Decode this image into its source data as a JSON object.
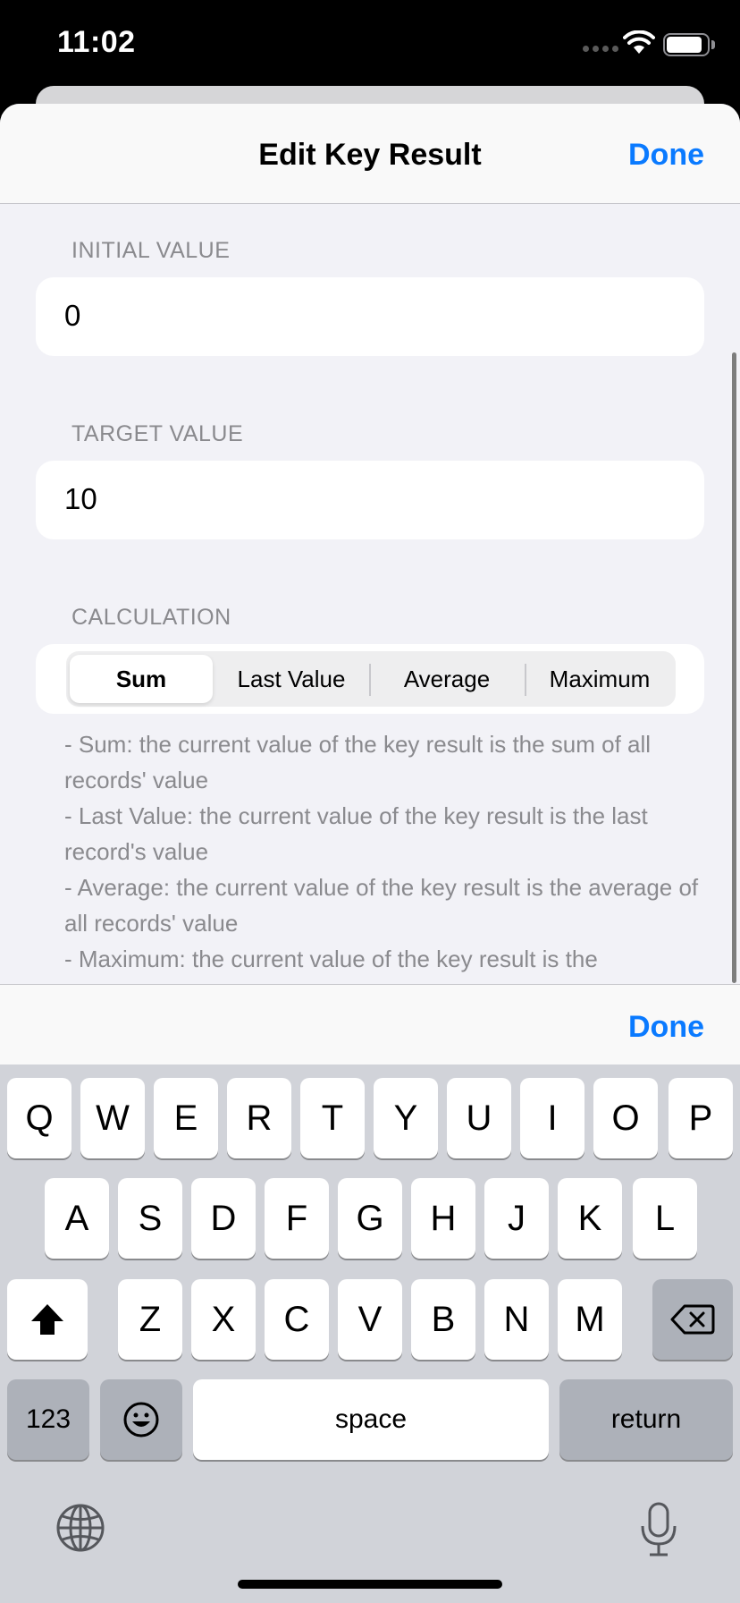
{
  "status_bar": {
    "time": "11:02"
  },
  "nav": {
    "title": "Edit Key Result",
    "done": "Done"
  },
  "form": {
    "initial_value": {
      "label": "INITIAL VALUE",
      "value": "0"
    },
    "target_value": {
      "label": "TARGET VALUE",
      "value": "10"
    },
    "calculation": {
      "label": "CALCULATION",
      "options": [
        "Sum",
        "Last Value",
        "Average",
        "Maximum"
      ],
      "selected": "Sum",
      "help": [
        "- Sum: the current value of the key result is the sum of all records' value",
        "- Last Value: the current value of the key result is the last record's value",
        "- Average: the current value of the key result is the average of all records' value",
        "- Maximum: the current value of the key result is the"
      ]
    }
  },
  "accessory": {
    "done": "Done"
  },
  "keyboard": {
    "row1": [
      "Q",
      "W",
      "E",
      "R",
      "T",
      "Y",
      "U",
      "I",
      "O",
      "P"
    ],
    "row2": [
      "A",
      "S",
      "D",
      "F",
      "G",
      "H",
      "J",
      "K",
      "L"
    ],
    "row3": [
      "Z",
      "X",
      "C",
      "V",
      "B",
      "N",
      "M"
    ],
    "numbers": "123",
    "space": "space",
    "return": "return"
  },
  "colors": {
    "accent": "#0a7aff",
    "sheet_bg": "#f2f2f7",
    "keyboard_bg": "#d1d3d9"
  },
  "icons": [
    "wifi-icon",
    "battery-icon",
    "shift-icon",
    "delete-icon",
    "emoji-icon",
    "globe-icon",
    "microphone-icon"
  ]
}
